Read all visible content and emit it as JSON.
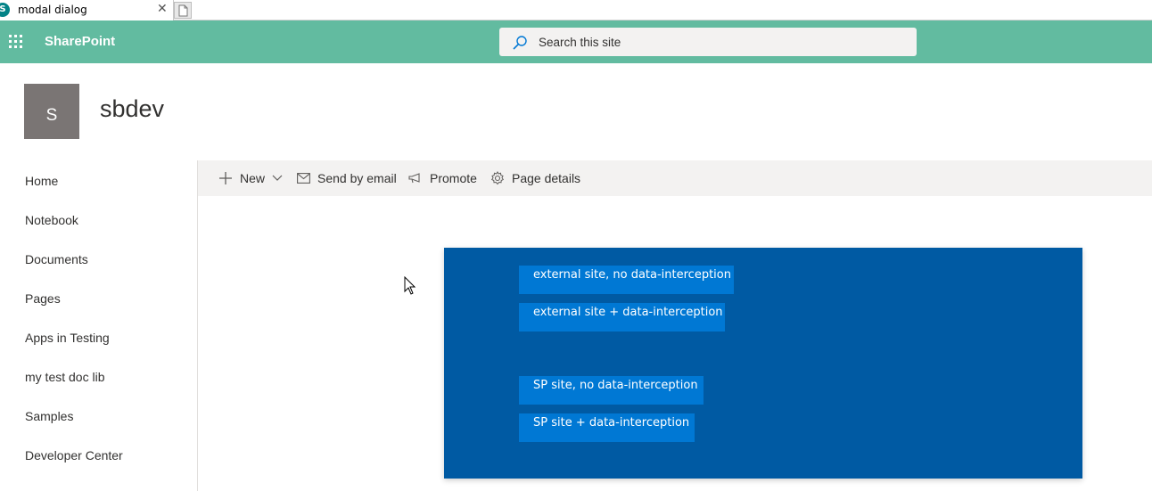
{
  "browser": {
    "tab_title": "modal dialog",
    "tab_close": "✕",
    "favicon_letter": "S"
  },
  "suitebar": {
    "app_name": "SharePoint",
    "search_placeholder": "Search this site",
    "color": "#62bba0"
  },
  "site": {
    "logo_letter": "S",
    "title": "sbdev"
  },
  "nav": {
    "items": [
      {
        "label": "Home"
      },
      {
        "label": "Notebook"
      },
      {
        "label": "Documents"
      },
      {
        "label": "Pages"
      },
      {
        "label": "Apps in Testing"
      },
      {
        "label": "my test doc lib"
      },
      {
        "label": "Samples"
      },
      {
        "label": "Developer Center"
      }
    ]
  },
  "commandbar": {
    "new_label": "New",
    "send_label": "Send by email",
    "promote_label": "Promote",
    "details_label": "Page details"
  },
  "panel": {
    "color": "#005aa3",
    "button_color": "#0078d4",
    "buttons": [
      {
        "label": "external site, no data-interception"
      },
      {
        "label": "external site + data-interception"
      },
      {
        "label": "SP site, no data-interception"
      },
      {
        "label": "SP site + data-interception"
      }
    ]
  }
}
